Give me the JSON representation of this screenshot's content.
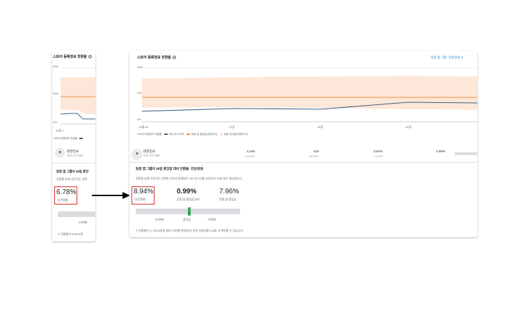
{
  "left_panel": {
    "title": "스토어 등록정보 전환율",
    "help": "?",
    "y_ticks": [
      "40%",
      "20%",
      "0%"
    ],
    "x_tick": "11월 1",
    "legend_label": "스토어 등록정보 전환율",
    "region": "대한민국",
    "region_sub": "이전 기간 대비",
    "peer_title": "동종 앱 그룹의 28일 중앙",
    "peer_desc": "전환율 업계 기준치는 선택",
    "my_rate": "6.78%",
    "my_rate_label": "내 전환율",
    "p25_label": "25번째",
    "tip": "전환율이 8.33%(동"
  },
  "right_panel": {
    "title": "스토어 등록정보 전환율",
    "help": "?",
    "peer_group_selector": "동종 앱 그룹: 건강/운동",
    "chevron": "▾",
    "y_ticks": [
      "40%",
      "20%",
      "0%"
    ],
    "x_ticks": [
      "12월 26",
      "27일",
      "28일",
      "29일"
    ],
    "legend": {
      "title": "스토어 등록정보 전환율",
      "items": [
        "모든 국가/지역",
        "동종 앱 중앙값(대한민국)",
        "동종 앱 범위(대한민국)"
      ]
    },
    "table_row": {
      "region": "대한민국",
      "region_sub": "이전 기간 대비",
      "values": [
        "2,449",
        "219",
        "8.94%",
        "0.99%"
      ],
      "deltas": [
        "-13.97%",
        "+42.21%",
        "+3.47%",
        "-"
      ]
    },
    "peer_title": "동종 앱 그룹의 28일 중앙값 대비 전환율: 건강/운동",
    "peer_desc": "전환율 업계 기준치는 선택한 기간과 관계없이 2021년 12월 30일까지 28일 동안 계산됩니다.",
    "my_rate": "8.94%",
    "my_rate_label": "내 전환율",
    "vs_median": "0.99%",
    "vs_median_label": "동종 앱 중앙값 대비",
    "peer_median": "7.96%",
    "peer_median_label": "동종 앱 중앙값",
    "scale_labels": [
      "25번째",
      "중앙값",
      "75번째"
    ],
    "tip": "전환율이 17.35%(동종 앱의 75번째 백분위)가 되면 사용자를 206명 더 획득할 수 있습니다."
  },
  "colors": {
    "line_all": "#3e5f7e",
    "line_median": "#e8924a",
    "band": "#fde7d8",
    "highlight": "#d93025",
    "marker": "#34a853",
    "link": "#1a73e8"
  }
}
